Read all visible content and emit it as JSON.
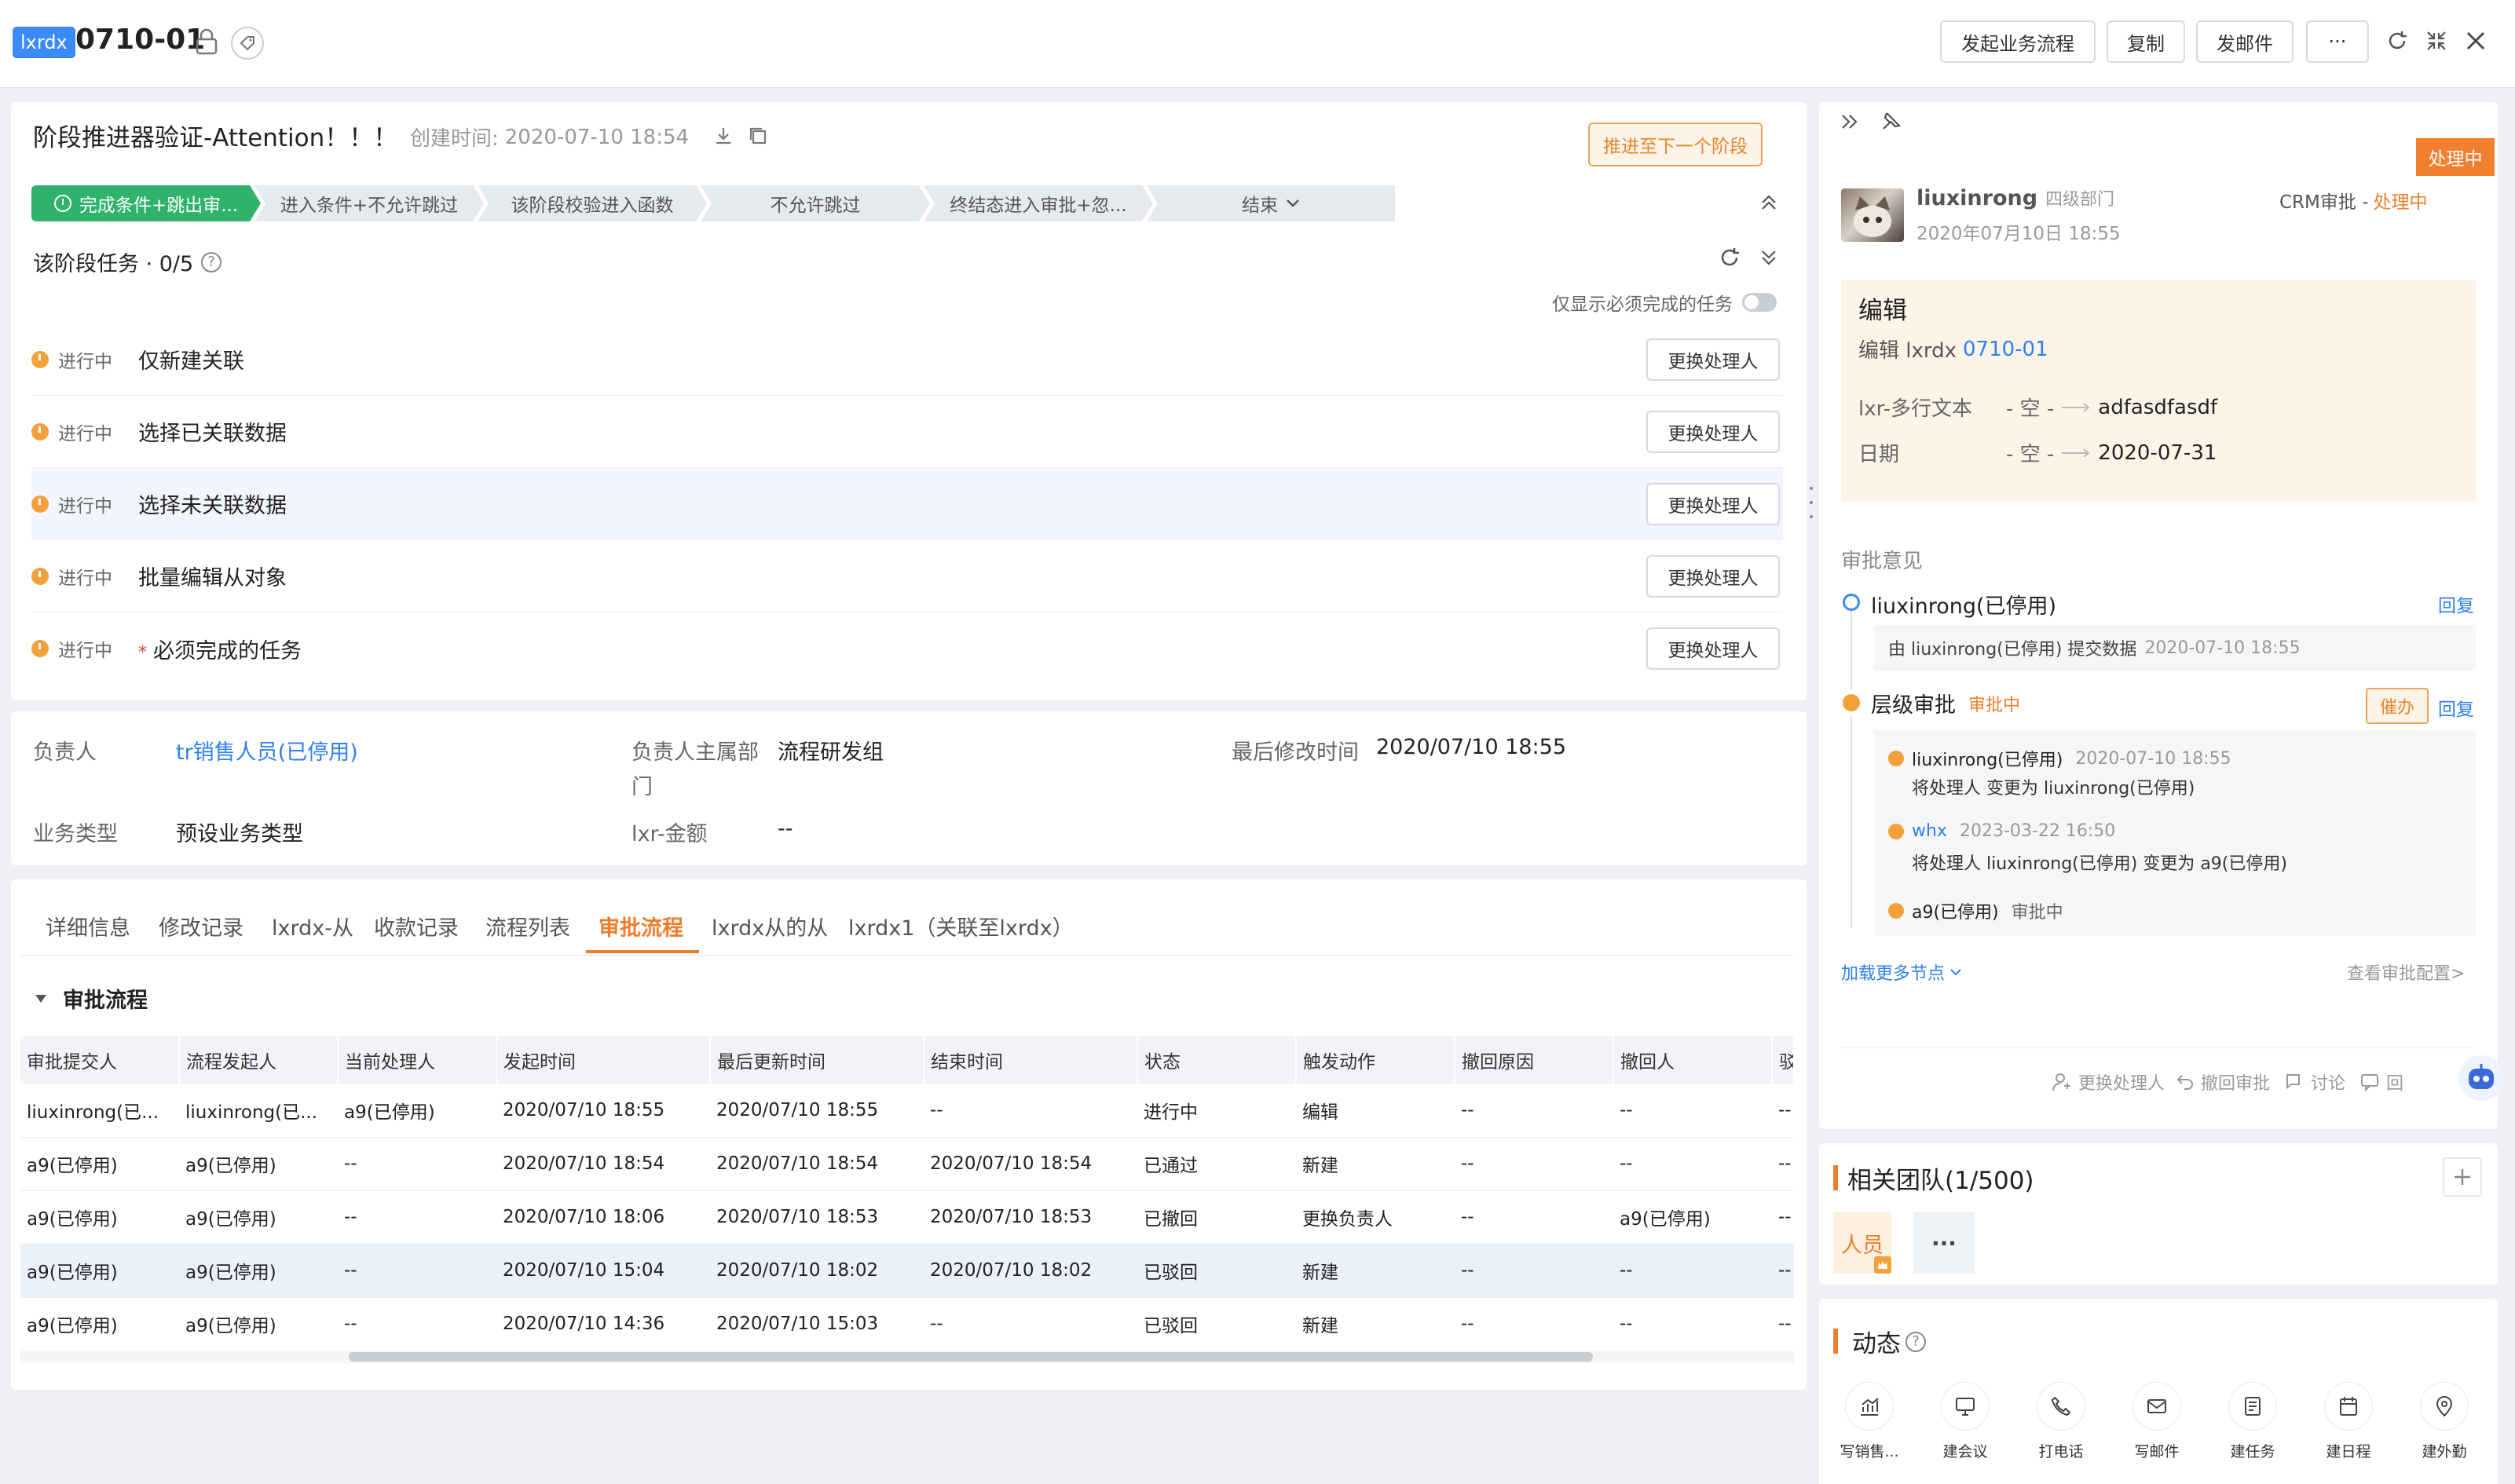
{
  "header": {
    "badge": "lxrdx",
    "title": "0710-01",
    "buttons": {
      "start_flow": "发起业务流程",
      "copy": "复制",
      "send_mail": "发邮件",
      "more": "···"
    }
  },
  "stage": {
    "title": "阶段推进器验证-Attention！！！",
    "created_label": "创建时间:",
    "created_value": "2020-07-10 18:54",
    "advance_button": "推进至下一个阶段",
    "steps": [
      "完成条件+跳出审...",
      "进入条件+不允许跳过",
      "该阶段校验进入函数",
      "不允许跳过",
      "终结态进入审批+忽...",
      "结束"
    ],
    "tasks_label": "该阶段任务 · 0/5",
    "only_required_label": "仅显示必须完成的任务",
    "tasks": [
      {
        "status": "进行中",
        "name": "仅新建关联",
        "required": false,
        "action": "更换处理人"
      },
      {
        "status": "进行中",
        "name": "选择已关联数据",
        "required": false,
        "action": "更换处理人"
      },
      {
        "status": "进行中",
        "name": "选择未关联数据",
        "required": false,
        "action": "更换处理人"
      },
      {
        "status": "进行中",
        "name": "批量编辑从对象",
        "required": false,
        "action": "更换处理人"
      },
      {
        "status": "进行中",
        "name": "必须完成的任务",
        "required": true,
        "action": "更换处理人"
      }
    ],
    "required_mark": "*"
  },
  "fields": {
    "owner_label": "负责人",
    "owner_value": "tr销售人员(已停用)",
    "dept_label_1": "负责人主属部",
    "dept_label_2": "门",
    "dept_value": "流程研发组",
    "modified_label": "最后修改时间",
    "modified_value": "2020/07/10 18:55",
    "biztype_label": "业务类型",
    "biztype_value": "预设业务类型",
    "amount_label": "lxr-金额",
    "amount_value": "--"
  },
  "tabs": [
    "详细信息",
    "修改记录",
    "lxrdx-从",
    "收款记录",
    "流程列表",
    "审批流程",
    "lxrdx从的从",
    "lxrdx1（关联至lxrdx）"
  ],
  "approval": {
    "section_title": "审批流程",
    "columns": [
      "审批提交人",
      "流程发起人",
      "当前处理人",
      "发起时间",
      "最后更新时间",
      "结束时间",
      "状态",
      "触发动作",
      "撤回原因",
      "撤回人",
      "驳"
    ],
    "rows": [
      [
        "liuxinrong(已...",
        "liuxinrong(已...",
        "a9(已停用)",
        "2020/07/10 18:55",
        "2020/07/10 18:55",
        "--",
        "进行中",
        "编辑",
        "--",
        "--",
        "--"
      ],
      [
        "a9(已停用)",
        "a9(已停用)",
        "--",
        "2020/07/10 18:54",
        "2020/07/10 18:54",
        "2020/07/10 18:54",
        "已通过",
        "新建",
        "--",
        "--",
        "--"
      ],
      [
        "a9(已停用)",
        "a9(已停用)",
        "--",
        "2020/07/10 18:06",
        "2020/07/10 18:53",
        "2020/07/10 18:53",
        "已撤回",
        "更换负责人",
        "--",
        "a9(已停用)",
        "--"
      ],
      [
        "a9(已停用)",
        "a9(已停用)",
        "--",
        "2020/07/10 15:04",
        "2020/07/10 18:02",
        "2020/07/10 18:02",
        "已驳回",
        "新建",
        "--",
        "--",
        "--"
      ],
      [
        "a9(已停用)",
        "a9(已停用)",
        "--",
        "2020/07/10 14:36",
        "2020/07/10 15:03",
        "--",
        "已驳回",
        "新建",
        "--",
        "--",
        "--"
      ]
    ]
  },
  "right_panel": {
    "status_badge": "处理中",
    "user_name": "liuxinrong",
    "user_dept": "四级部门",
    "user_time": "2020年07月10日 18:55",
    "flow_type": "CRM审批 - ",
    "flow_status": "处理中",
    "edit_title": "编辑",
    "edit_desc_prefix": "编辑 lxrdx ",
    "edit_desc_link": "0710-01",
    "changes": [
      {
        "field": "lxr-多行文本",
        "from": "- 空 -",
        "to": "adfasdfasdf"
      },
      {
        "field": "日期",
        "from": "- 空 -",
        "to": "2020-07-31"
      }
    ],
    "opinion_label": "审批意见",
    "node1_name": "liuxinrong(已停用)",
    "reply": "回复",
    "node1_note": "由 liuxinrong(已停用) 提交数据",
    "node1_time": "2020-07-10 18:55",
    "node2_name": "层级审批",
    "node2_status": "审批中",
    "urge": "催办",
    "sub1_name": "liuxinrong(已停用)",
    "sub1_time": "2020-07-10 18:55",
    "sub1_desc": "将处理人 变更为 liuxinrong(已停用)",
    "sub2_name": "whx",
    "sub2_time": "2023-03-22 16:50",
    "sub2_desc": "将处理人 liuxinrong(已停用) 变更为 a9(已停用)",
    "sub3_name": "a9(已停用)",
    "sub3_status": "审批中",
    "load_more": "加载更多节点",
    "view_config": "查看审批配置>",
    "bottom_actions": [
      "更换处理人",
      "撤回审批",
      "讨论",
      "回"
    ]
  },
  "team": {
    "title": "相关团队(1/500)",
    "member_label": "人员",
    "more": "···"
  },
  "dynamics": {
    "title": "动态",
    "actions": [
      "写销售...",
      "建会议",
      "打电话",
      "写邮件",
      "建任务",
      "建日程",
      "建外勤"
    ]
  },
  "colors": {
    "accent": "#ef7d2d",
    "link": "#2f7ff0",
    "green": "#2fb36b",
    "orange": "#f3a13a"
  }
}
